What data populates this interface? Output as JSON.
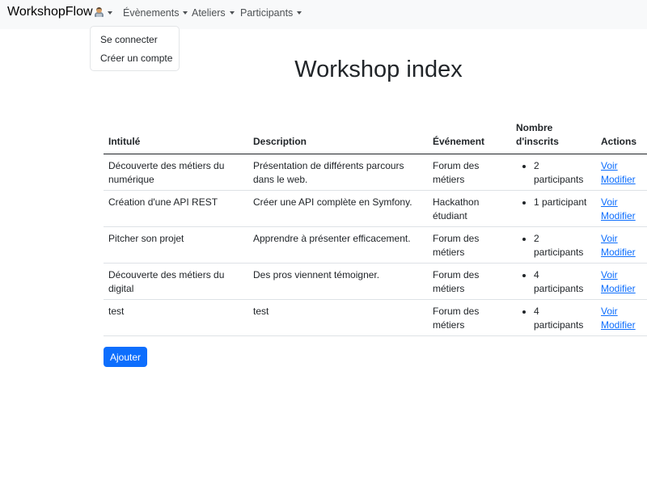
{
  "navbar": {
    "brand": "WorkshopFlow",
    "user_icon": "technologist-emoji-icon",
    "items": [
      {
        "label": "Évènements"
      },
      {
        "label": "Ateliers"
      },
      {
        "label": "Participants"
      }
    ],
    "user_menu": {
      "items": [
        {
          "label": "Se connecter"
        },
        {
          "label": "Créer un compte"
        }
      ]
    }
  },
  "main": {
    "title": "Workshop index",
    "table": {
      "headers": [
        "Intitulé",
        "Description",
        "Événement",
        "Nombre d'inscrits",
        "Actions"
      ],
      "rows": [
        {
          "intitule": "Découverte des métiers du numérique",
          "description": "Présentation de différents parcours dans le web.",
          "evenement": "Forum des métiers",
          "inscrits": "2 participants",
          "voir": "Voir",
          "modifier": "Modifier"
        },
        {
          "intitule": "Création d'une API REST",
          "description": "Créer une API complète en Symfony.",
          "evenement": "Hackathon étudiant",
          "inscrits": "1 participant",
          "voir": "Voir",
          "modifier": "Modifier"
        },
        {
          "intitule": "Pitcher son projet",
          "description": "Apprendre à présenter efficacement.",
          "evenement": "Forum des métiers",
          "inscrits": "2 participants",
          "voir": "Voir",
          "modifier": "Modifier"
        },
        {
          "intitule": "Découverte des métiers du digital",
          "description": "Des pros viennent témoigner.",
          "evenement": "Forum des métiers",
          "inscrits": "4 participants",
          "voir": "Voir",
          "modifier": "Modifier"
        },
        {
          "intitule": "test",
          "description": "test",
          "evenement": "Forum des métiers",
          "inscrits": "4 participants",
          "voir": "Voir",
          "modifier": "Modifier"
        }
      ]
    },
    "add_button": "Ajouter"
  },
  "colors": {
    "navbar_bg": "#f8f9fa",
    "primary": "#0d6efd",
    "text": "#212529",
    "row_border": "#dee2e6"
  }
}
